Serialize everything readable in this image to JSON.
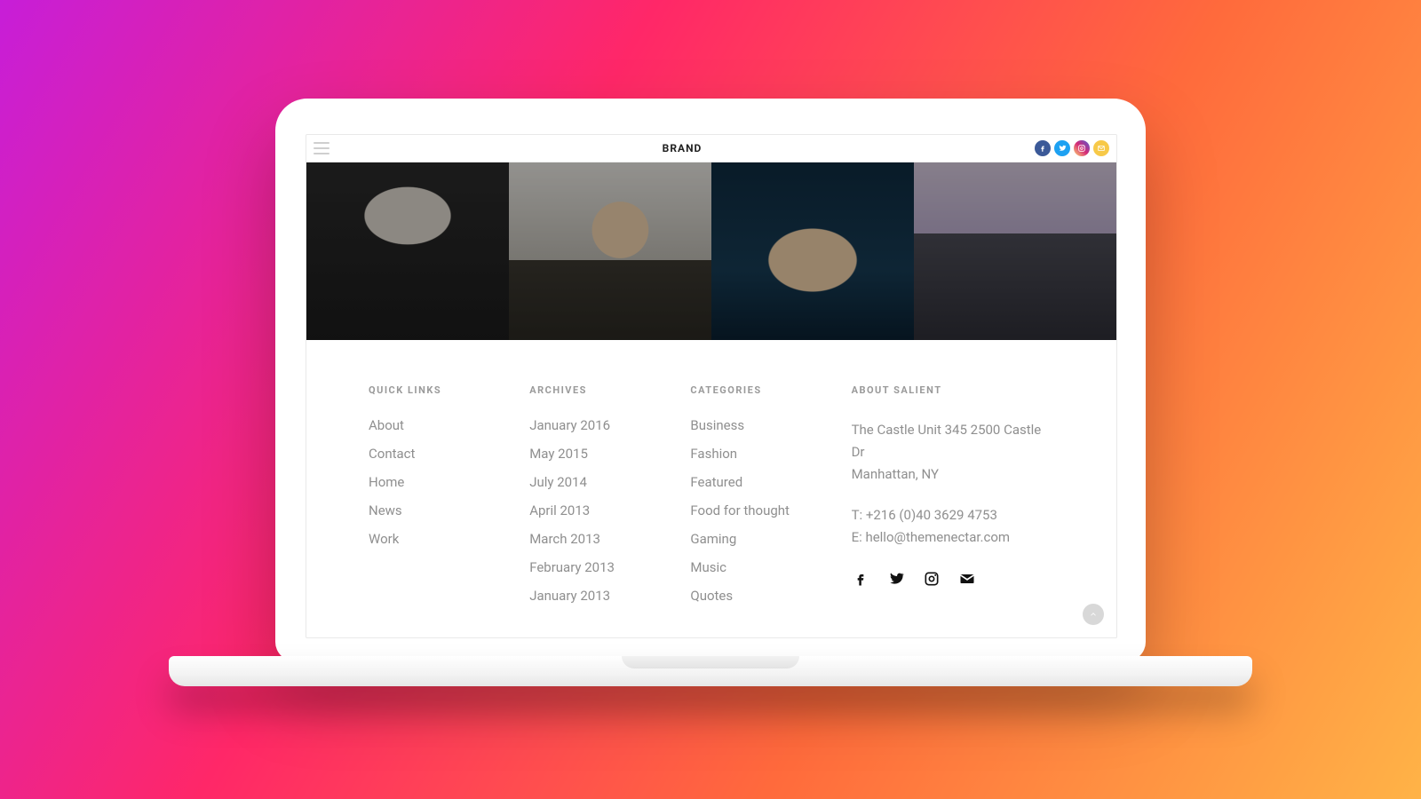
{
  "header": {
    "brand": "BRAND",
    "socials": [
      "facebook",
      "twitter",
      "instagram",
      "email"
    ]
  },
  "gallery": {
    "items": [
      "photo-cyclist",
      "photo-office",
      "photo-boat",
      "photo-mountains"
    ]
  },
  "footer": {
    "quick_links": {
      "title": "QUICK LINKS",
      "items": [
        "About",
        "Contact",
        "Home",
        "News",
        "Work"
      ]
    },
    "archives": {
      "title": "ARCHIVES",
      "items": [
        "January 2016",
        "May 2015",
        "July 2014",
        "April 2013",
        "March 2013",
        "February 2013",
        "January 2013"
      ]
    },
    "categories": {
      "title": "CATEGORIES",
      "items": [
        "Business",
        "Fashion",
        "Featured",
        "Food for thought",
        "Gaming",
        "Music",
        "Quotes"
      ]
    },
    "about": {
      "title": "ABOUT SALIENT",
      "address": "The Castle Unit 345 2500 Castle Dr\nManhattan, NY",
      "phone": "T: +216 (0)40 3629 4753",
      "email": "E: hello@themenectar.com",
      "socials": [
        "facebook",
        "twitter",
        "instagram",
        "email"
      ]
    }
  }
}
